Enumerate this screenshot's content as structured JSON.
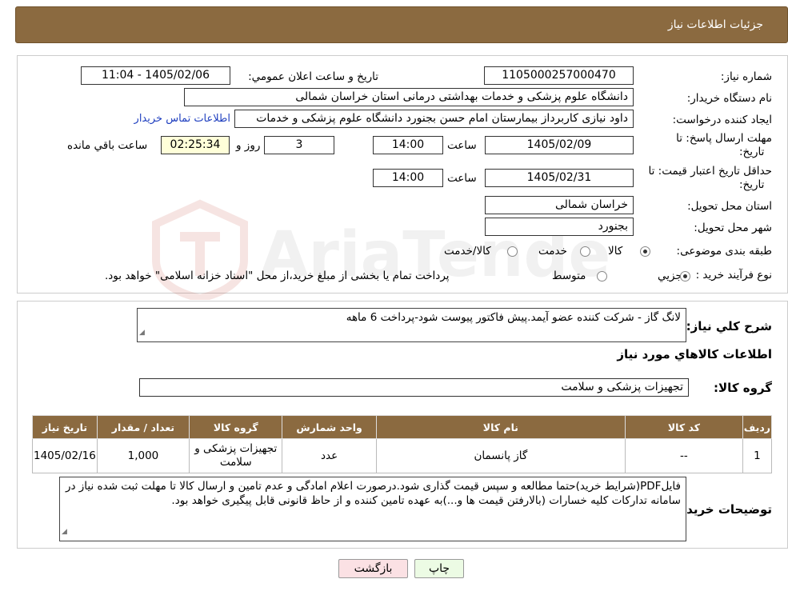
{
  "header": {
    "title": "جزئیات اطلاعات نیاز"
  },
  "form": {
    "need_number_label": "شماره نیاز:",
    "need_number": "1105000257000470",
    "announce_label": "تاریخ و ساعت اعلان عمومي:",
    "announce_value": "1405/02/06 - 11:04",
    "buyer_org_label": "نام دستگاه خريدار:",
    "buyer_org": "دانشگاه علوم پزشکی و خدمات بهداشتی درمانی استان خراسان شمالی",
    "creator_label": "ايجاد کننده درخواست:",
    "creator": "داود نیازی کاربرداز بیمارستان امام حسن بجنورد دانشگاه علوم پزشکی و خدمات",
    "contact_link": "اطلاعات تماس خريدار",
    "deadline_label_1": "مهلت ارسال پاسخ: تا",
    "deadline_label_2": "تاريخ:",
    "deadline_date": "1405/02/09",
    "time_label": "ساعت",
    "deadline_time": "14:00",
    "days": "3",
    "days_label": "روز و",
    "remaining_time": "02:25:34",
    "remaining_label": "ساعت باقي مانده",
    "validity_label_1": "حداقل تاريخ اعتبار قيمت: تا",
    "validity_label_2": "تاريخ:",
    "validity_date": "1405/02/31",
    "validity_time": "14:00",
    "province_label": "استان محل تحويل:",
    "province": "خراسان شمالی",
    "city_label": "شهر محل تحويل:",
    "city": "بجنورد",
    "category_label": "طبقه بندی موضوعی:",
    "category_options": [
      "کالا",
      "خدمت",
      "کالا/خدمت"
    ],
    "process_label": "نوع فرآيند خريد :",
    "process_options": [
      "جزيي",
      "متوسط"
    ],
    "process_note": "پرداخت تمام يا بخشی از مبلغ خريد،از محل \"اسناد خزانه اسلامی\" خواهد بود."
  },
  "summary": {
    "label": "شرح کلي نياز:",
    "text": "لانگ گاز - شرکت کننده عضو آیمد.پیش فاکتور پیوست  شود-پرداخت 6 ماهه"
  },
  "goods": {
    "section_title": "اطلاعات کالاهاي مورد نياز",
    "group_label": "گروه کالا:",
    "group_value": "تجهیزات پزشکی و سلامت",
    "columns": [
      "رديف",
      "کد کالا",
      "نام کالا",
      "واحد شمارش",
      "گروه کالا",
      "تعداد / مقدار",
      "تاريخ نياز"
    ],
    "rows": [
      [
        "1",
        "--",
        "گاز پانسمان",
        "عدد",
        "تجهیزات پزشکی و سلامت",
        "1,000",
        "1405/02/16"
      ]
    ]
  },
  "notes": {
    "label": "توضيحات خريدار:",
    "text": "فایلPDF(شرایط خرید)حتما مطالعه و سپس قیمت گذاری شود.درصورت اعلام امادگی و عدم تامین و ارسال کالا تا مهلت ثبت شده نیاز در سامانه تدارکات کلیه خسارات (بالارفتن قیمت ها و...)به عهده تامین کننده و از حاظ قانونی قابل پیگیری خواهد بود."
  },
  "buttons": {
    "print": "چاپ",
    "back": "بازگشت"
  },
  "colors": {
    "header": "#8b6a40",
    "print_bg": "#ecfbe4",
    "back_bg": "#fbe1e4",
    "link": "#1f3fbf"
  },
  "watermark": "AriaTender.neT"
}
